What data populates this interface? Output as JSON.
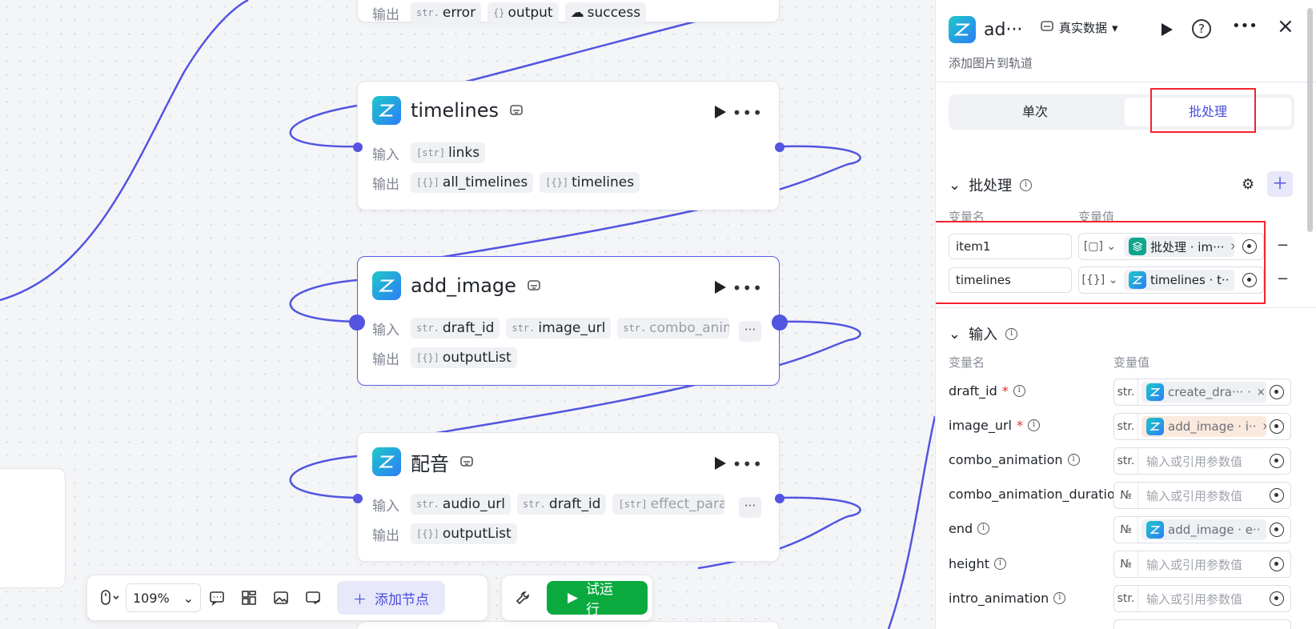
{
  "canvas": {
    "nodes": [
      {
        "title": "timelines",
        "in_label": "输入",
        "out_label": "输出",
        "inputs": [
          {
            "type": "[str]",
            "name": "links"
          }
        ],
        "outputs": [
          {
            "type": "[{}]",
            "name": "all_timelines"
          },
          {
            "type": "[{}]",
            "name": "timelines"
          }
        ]
      },
      {
        "title": "add_image",
        "in_label": "输入",
        "out_label": "输出",
        "inputs": [
          {
            "type": "str.",
            "name": "draft_id"
          },
          {
            "type": "str.",
            "name": "image_url"
          },
          {
            "type": "str.",
            "name": "combo_anim"
          }
        ],
        "outputs": [
          {
            "type": "[{}]",
            "name": "outputList"
          }
        ],
        "more": "···"
      },
      {
        "title": "配音",
        "in_label": "输入",
        "out_label": "输出",
        "inputs": [
          {
            "type": "str.",
            "name": "audio_url"
          },
          {
            "type": "str.",
            "name": "draft_id"
          },
          {
            "type": "[str]",
            "name": "effect_param"
          }
        ],
        "outputs": [
          {
            "type": "[{}]",
            "name": "outputList"
          }
        ],
        "more": "···"
      }
    ],
    "top_node_partial": {
      "outputs": [
        {
          "type": "str.",
          "name": "error"
        },
        {
          "type": "{}",
          "name": "output"
        },
        {
          "type": "",
          "name": "success"
        }
      ]
    }
  },
  "toolbar": {
    "zoom": "109%",
    "add_node": "添加节点",
    "test_run": "试运行"
  },
  "panel": {
    "title": "ad···",
    "data_mode": "真实数据",
    "subtitle": "添加图片到轨道",
    "tabs": [
      "单次",
      "批处理"
    ],
    "batch_section": "批处理",
    "col_var_name": "变量名",
    "col_var_value": "变量值",
    "batch_vars": [
      {
        "name": "item1",
        "type": "[▢]",
        "ref": "批处理 · im···"
      },
      {
        "name": "timelines",
        "type": "[{}]",
        "ref": "timelines · t··"
      }
    ],
    "input_section": "输入",
    "inputs": [
      {
        "name": "draft_id",
        "required": true,
        "type": "str.",
        "ref": "create_dra··· ·"
      },
      {
        "name": "image_url",
        "required": true,
        "type": "str.",
        "ref": "add_image · i··"
      },
      {
        "name": "combo_animation",
        "required": false,
        "type": "str.",
        "placeholder": "输入或引用参数值"
      },
      {
        "name": "combo_animation_duration",
        "required": false,
        "type": "№",
        "placeholder": "输入或引用参数值"
      },
      {
        "name": "end",
        "required": false,
        "type": "№",
        "ref": "add_image · e··"
      },
      {
        "name": "height",
        "required": false,
        "type": "№",
        "placeholder": "输入或引用参数值"
      },
      {
        "name": "intro_animation",
        "required": false,
        "type": "str.",
        "placeholder": "输入或引用参数值"
      }
    ],
    "close_x": "×",
    "minus": "−",
    "required_mark": "*",
    "info_glyph": "i"
  },
  "colors": {
    "accent": "#5355e0",
    "run": "#0aaa3f",
    "highlight": "#f5222d",
    "arrow": "#1e90ff"
  }
}
